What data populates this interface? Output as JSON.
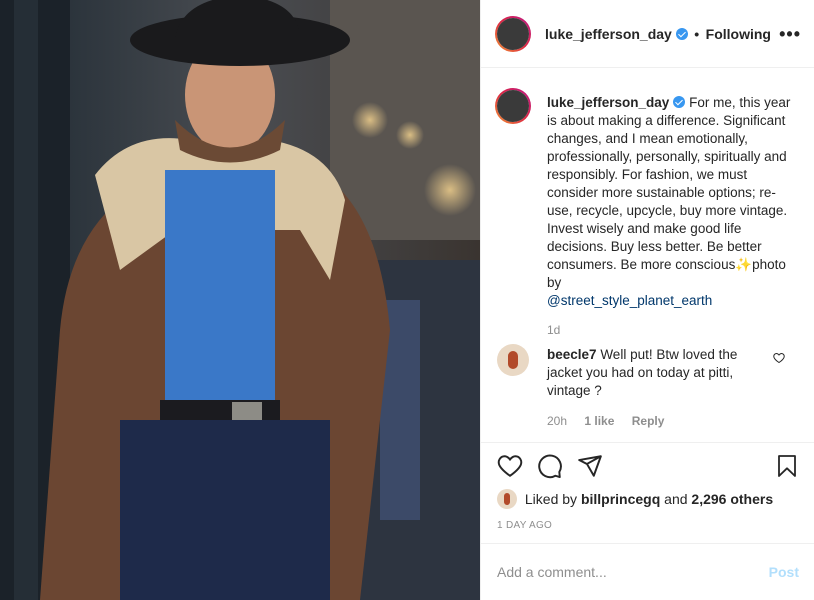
{
  "post": {
    "username": "luke_jefferson_day",
    "follow_separator": "•",
    "follow_status": "Following",
    "more_options": "•••",
    "caption_text": "For me, this year is about making a difference. Significant changes, and I mean emotionally, professionally, personally, spiritually and responsibly. For fashion, we must consider more sustainable options; re-use, recycle, upcycle, buy more vintage. Invest wisely and make good life decisions. Buy less better. Be better consumers. Be more conscious",
    "caption_emoji": "✨",
    "caption_tail": "photo by",
    "photo_credit": "@street_style_planet_earth",
    "caption_age": "1d"
  },
  "comment": {
    "username": "beecle7",
    "text": "Well put! Btw loved the jacket you had on today at pitti, vintage ?",
    "age": "20h",
    "likes": "1 like",
    "reply": "Reply"
  },
  "likes": {
    "prefix": "Liked by",
    "user": "billprincegq",
    "connector": "and",
    "others": "2,296 others"
  },
  "date": "1 DAY AGO",
  "add_comment": {
    "placeholder": "Add a comment...",
    "post_label": "Post"
  },
  "icons": {
    "like": "heart-icon",
    "comment": "comment-icon",
    "share": "share-icon",
    "save": "bookmark-icon"
  },
  "colors": {
    "verified": "#3897f0",
    "link": "#00376b",
    "muted": "#8e8e8e",
    "post_disabled": "#b2dffc"
  }
}
